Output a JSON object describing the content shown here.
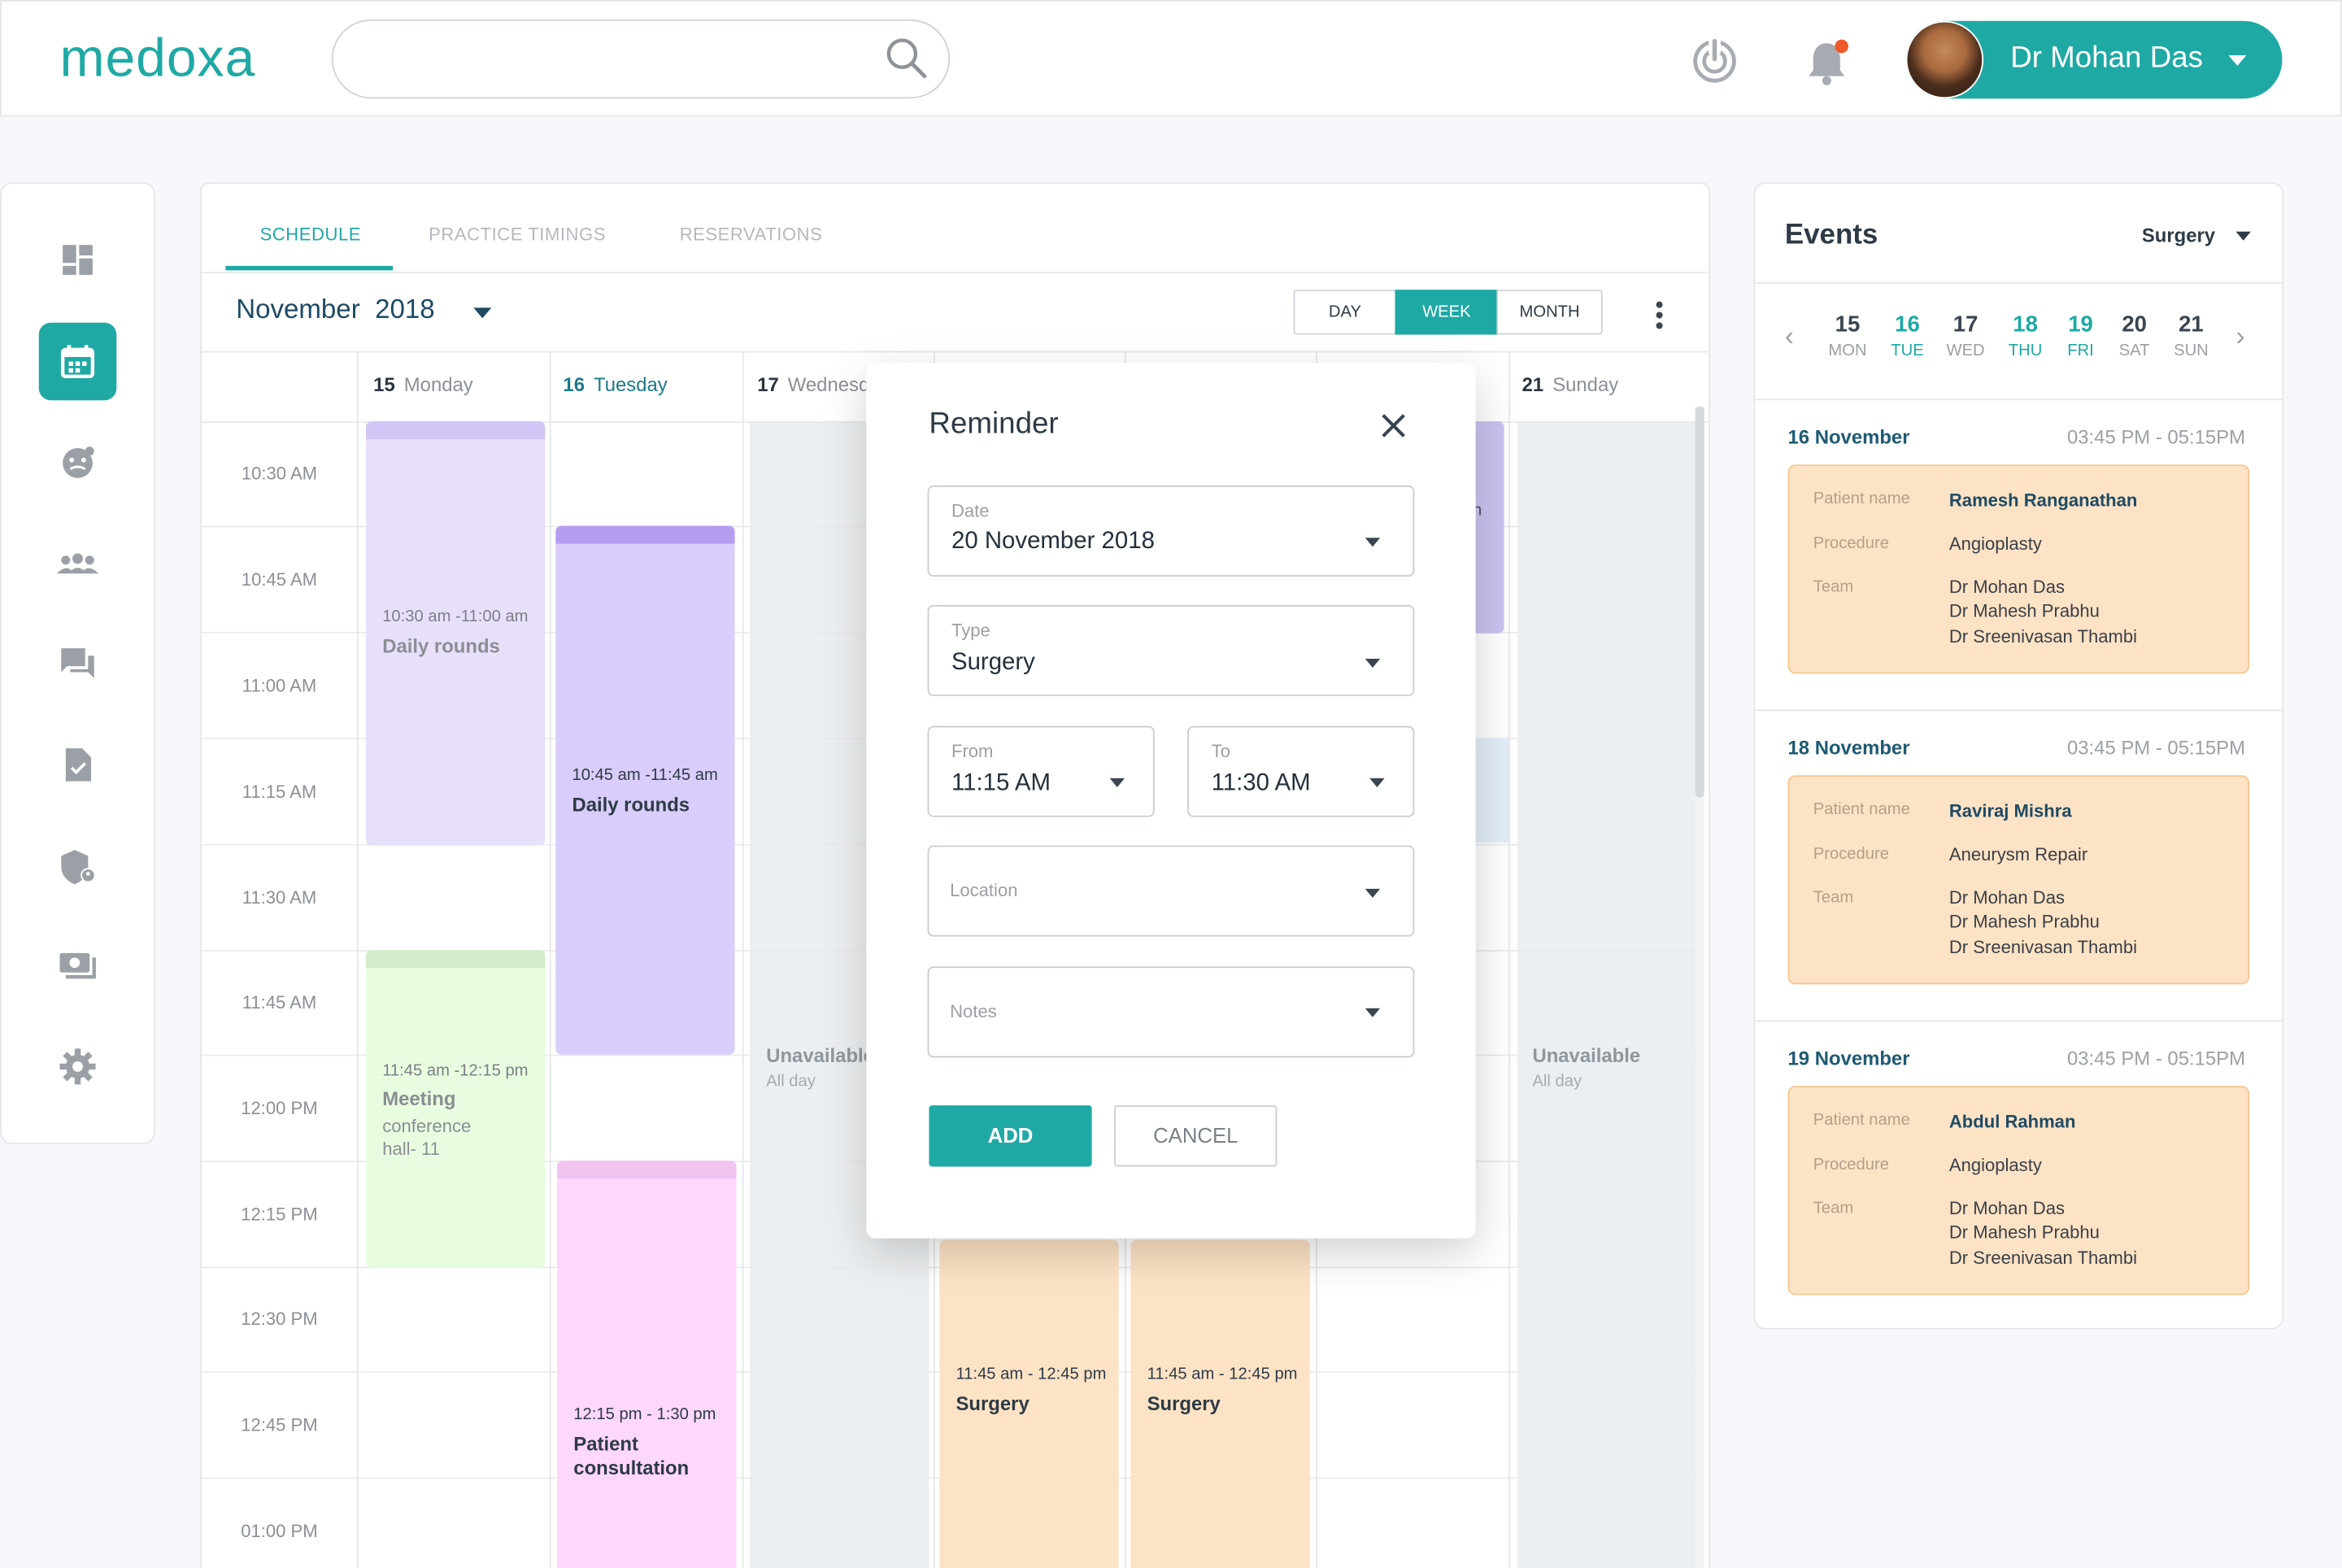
{
  "header": {
    "logo": "medoxa",
    "search_placeholder": "",
    "user_name": "Dr Mohan Das"
  },
  "tabs": [
    "SCHEDULE",
    "PRACTICE TIMINGS",
    "RESERVATIONS"
  ],
  "calendar": {
    "month": "November",
    "year": "2018",
    "views": [
      "DAY",
      "WEEK",
      "MONTH"
    ],
    "active_view": "WEEK",
    "days": [
      {
        "num": "15",
        "name": "Monday"
      },
      {
        "num": "16",
        "name": "Tuesday"
      },
      {
        "num": "17",
        "name": "Wednesd"
      },
      {
        "num": "21",
        "name": "Sunday"
      }
    ],
    "times": [
      "10:30 AM",
      "10:45 AM",
      "11:00 AM",
      "11:15 AM",
      "11:30 AM",
      "11:45 AM",
      "12:00 PM",
      "12:15 PM",
      "12:30 PM",
      "12:45 PM",
      "01:00 PM"
    ],
    "events": [
      {
        "time": "10:30 am -11:00 am",
        "title": "Daily rounds"
      },
      {
        "time": "10:45 am -11:45 am",
        "title": "Daily rounds"
      },
      {
        "time": "11:45 am -12:15 pm",
        "title": "Meeting",
        "sub": "conference hall- 11"
      },
      {
        "time": "12:15 pm - 1:30 pm",
        "title": "Patient consultation"
      },
      {
        "time": "11:45 am - 12:45 pm",
        "title": "Surgery"
      },
      {
        "time": "11:45 am - 12:45 pm",
        "title": "Surgery"
      },
      {
        "title": "n"
      }
    ],
    "unavailable": {
      "title": "Unavailable",
      "sub": "All day"
    }
  },
  "modal": {
    "title": "Reminder",
    "date_label": "Date",
    "date_value": "20 November 2018",
    "type_label": "Type",
    "type_value": "Surgery",
    "from_label": "From",
    "from_value": "11:15 AM",
    "to_label": "To",
    "to_value": "11:30 AM",
    "location_label": "Location",
    "notes_label": "Notes",
    "add_label": "ADD",
    "cancel_label": "CANCEL"
  },
  "events_panel": {
    "title": "Events",
    "filter": "Surgery",
    "week": [
      {
        "n": "15",
        "l": "MON",
        "hl": false
      },
      {
        "n": "16",
        "l": "TUE",
        "hl": true
      },
      {
        "n": "17",
        "l": "WED",
        "hl": false
      },
      {
        "n": "18",
        "l": "THU",
        "hl": true
      },
      {
        "n": "19",
        "l": "FRI",
        "hl": true
      },
      {
        "n": "20",
        "l": "SAT",
        "hl": false
      },
      {
        "n": "21",
        "l": "SUN",
        "hl": false
      }
    ],
    "labels": {
      "patient": "Patient name",
      "procedure": "Procedure",
      "team": "Team"
    },
    "items": [
      {
        "date": "16 November",
        "time": "03:45 PM - 05:15PM",
        "patient": "Ramesh Ranganathan",
        "procedure": "Angioplasty",
        "team": [
          "Dr Mohan Das",
          "Dr Mahesh Prabhu",
          "Dr Sreenivasan Thambi"
        ]
      },
      {
        "date": "18 November",
        "time": "03:45 PM - 05:15PM",
        "patient": "Raviraj Mishra",
        "procedure": "Aneurysm Repair",
        "team": [
          "Dr Mohan Das",
          "Dr Mahesh Prabhu",
          "Dr Sreenivasan Thambi"
        ]
      },
      {
        "date": "19 November",
        "time": "03:45 PM - 05:15PM",
        "patient": "Abdul Rahman",
        "procedure": "Angioplasty",
        "team": [
          "Dr Mohan Das",
          "Dr Mahesh Prabhu",
          "Dr Sreenivasan Thambi"
        ]
      }
    ]
  },
  "colors": {
    "accent": "#1fa9a4",
    "rounds": "#e4dbfb",
    "rounds_tue": "#d9cdfb",
    "meeting": "#e6fbdc",
    "consult": "#fdd7fc",
    "surgery": "#fde3c6",
    "unavailable": "#eceff1"
  }
}
